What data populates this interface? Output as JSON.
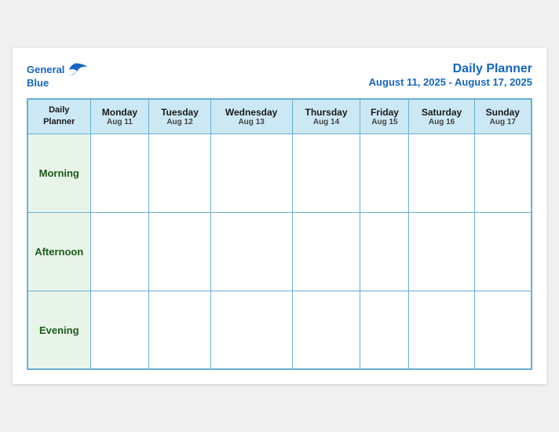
{
  "header": {
    "logo": {
      "line1": "General",
      "line2": "Blue"
    },
    "title": "Daily Planner",
    "date_range": "August 11, 2025 - August 17, 2025"
  },
  "table": {
    "header_first_line1": "Daily",
    "header_first_line2": "Planner",
    "columns": [
      {
        "day": "Monday",
        "date": "Aug 11"
      },
      {
        "day": "Tuesday",
        "date": "Aug 12"
      },
      {
        "day": "Wednesday",
        "date": "Aug 13"
      },
      {
        "day": "Thursday",
        "date": "Aug 14"
      },
      {
        "day": "Friday",
        "date": "Aug 15"
      },
      {
        "day": "Saturday",
        "date": "Aug 16"
      },
      {
        "day": "Sunday",
        "date": "Aug 17"
      }
    ],
    "rows": [
      {
        "label": "Morning"
      },
      {
        "label": "Afternoon"
      },
      {
        "label": "Evening"
      }
    ]
  }
}
